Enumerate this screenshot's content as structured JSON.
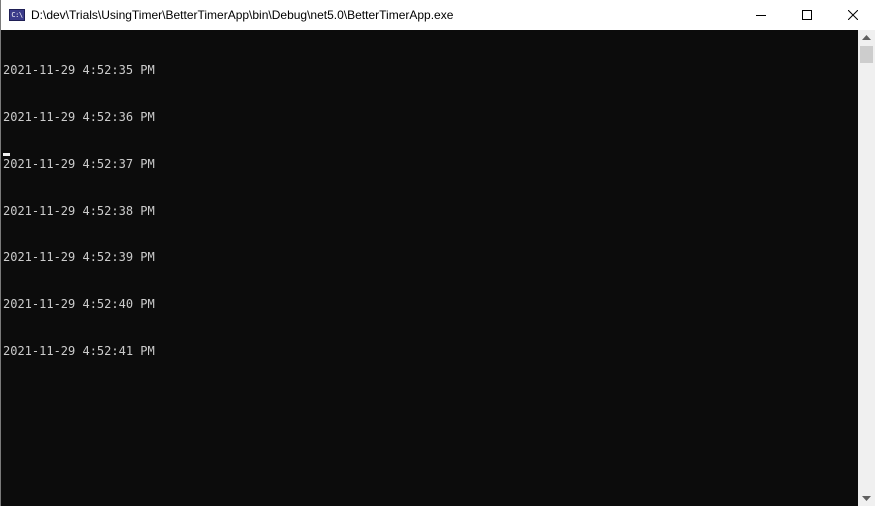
{
  "window": {
    "title": "D:\\dev\\Trials\\UsingTimer\\BetterTimerApp\\bin\\Debug\\net5.0\\BetterTimerApp.exe",
    "icon": "console-app-icon",
    "icon_text": "C:\\",
    "caption_buttons": [
      "minimize-icon",
      "maximize-icon",
      "close-icon"
    ]
  },
  "console": {
    "background": "#0c0c0c",
    "foreground": "#cccccc",
    "lines": [
      "2021-11-29 4:52:35 PM",
      "2021-11-29 4:52:36 PM",
      "2021-11-29 4:52:37 PM",
      "2021-11-29 4:52:38 PM",
      "2021-11-29 4:52:39 PM",
      "2021-11-29 4:52:40 PM",
      "2021-11-29 4:52:41 PM"
    ]
  },
  "scrollbar": {
    "up_icon": "scroll-up-arrow-icon",
    "down_icon": "scroll-down-arrow-icon"
  }
}
